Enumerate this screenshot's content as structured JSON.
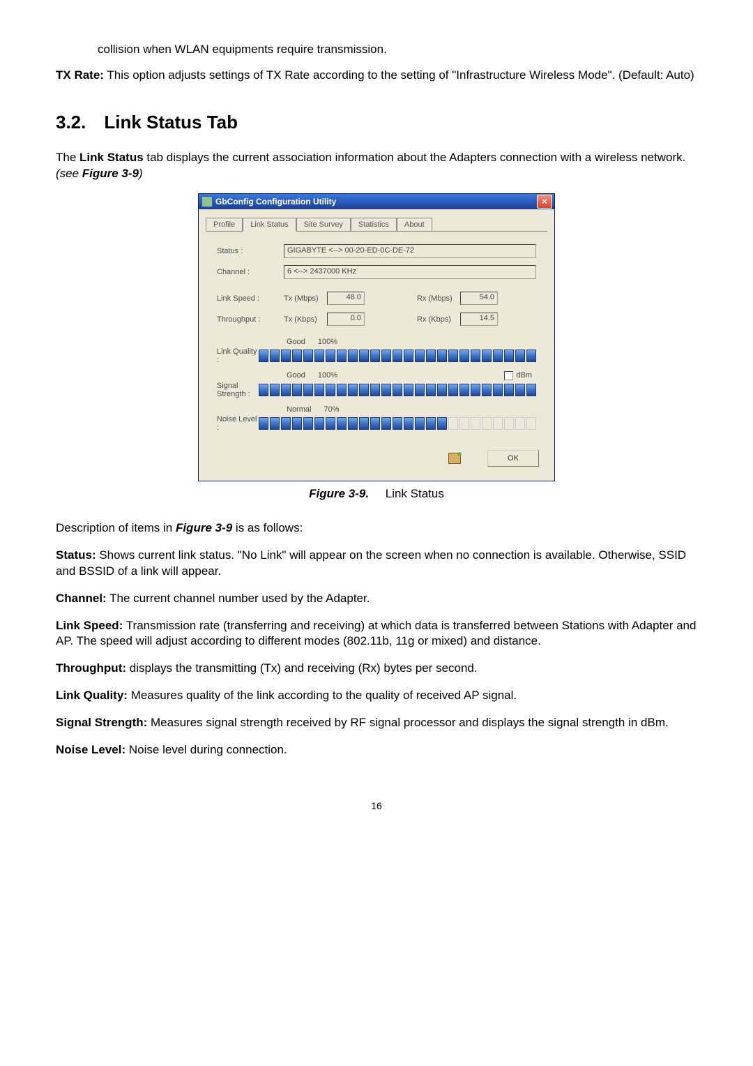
{
  "intro1": "collision when WLAN equipments require transmission.",
  "txrate_label": "TX Rate:",
  "txrate_body": " This option adjusts settings of TX Rate according to the setting of \"Infrastructure Wireless Mode\". (Default: Auto)",
  "heading": "3.2. Link Status Tab",
  "para1_a": "The ",
  "para1_b": "Link Status",
  "para1_c": " tab displays the current association information about the Adapters connection with a wireless network. ",
  "para1_d": "(see ",
  "para1_e": "Figure 3-9",
  "para1_f": ")",
  "dialog": {
    "title": "GbConfig Configuration Utility",
    "tabs": [
      "Profile",
      "Link Status",
      "Site Survey",
      "Statistics",
      "About"
    ],
    "active_tab_index": 1,
    "fields": {
      "status_label": "Status :",
      "status_value": "GIGABYTE <--> 00-20-ED-0C-DE-72",
      "channel_label": "Channel :",
      "channel_value": "6 <--> 2437000 KHz",
      "linkspeed_label": "Link Speed :",
      "tx_mbps_label": "Tx (Mbps)",
      "tx_mbps_value": "48.0",
      "rx_mbps_label": "Rx (Mbps)",
      "rx_mbps_value": "54.0",
      "throughput_label": "Throughput :",
      "tx_kbps_label": "Tx (Kbps)",
      "tx_kbps_value": "0.0",
      "rx_kbps_label": "Rx (Kbps)",
      "rx_kbps_value": "14.5",
      "link_quality_label": "Link Quality :",
      "link_quality_status": "Good",
      "link_quality_pct": "100%",
      "link_quality_segments": 25,
      "link_quality_filled": 25,
      "signal_label": "Signal Strength :",
      "signal_status": "Good",
      "signal_pct": "100%",
      "signal_segments": 25,
      "signal_filled": 25,
      "dbm_label": "dBm",
      "noise_label": "Noise Level :",
      "noise_status": "Normal",
      "noise_pct": "70%",
      "noise_segments": 25,
      "noise_filled": 17
    },
    "ok": "OK"
  },
  "caption_fig": "Figure 3-9.",
  "caption_text": "Link Status",
  "desc_intro_a": "Description of items in ",
  "desc_intro_b": "Figure 3-9",
  "desc_intro_c": " is as follows:",
  "defs": {
    "status_l": "Status:",
    "status_b": " Shows current link status. \"No Link\" will appear on the screen when no connection is available. Otherwise, SSID and BSSID of a link will appear.",
    "channel_l": "Channel:",
    "channel_b": " The current channel number used by the Adapter.",
    "linkspeed_l": "Link Speed:",
    "linkspeed_b": " Transmission rate (transferring and receiving) at which data is transferred between Stations with Adapter and AP. The speed will adjust according to different modes (802.11b, 11g or mixed) and distance.",
    "throughput_l": "Throughput:",
    "throughput_b": " displays the transmitting (Tx) and receiving (Rx) bytes per second.",
    "lq_l": "Link Quality:",
    "lq_b": " Measures quality of the link according to the quality of received AP signal.",
    "ss_l": "Signal Strength:",
    "ss_b": " Measures signal strength received by RF signal processor and displays the signal strength in dBm.",
    "noise_l": "Noise Level:",
    "noise_b": " Noise level during connection."
  },
  "page_number": "16"
}
